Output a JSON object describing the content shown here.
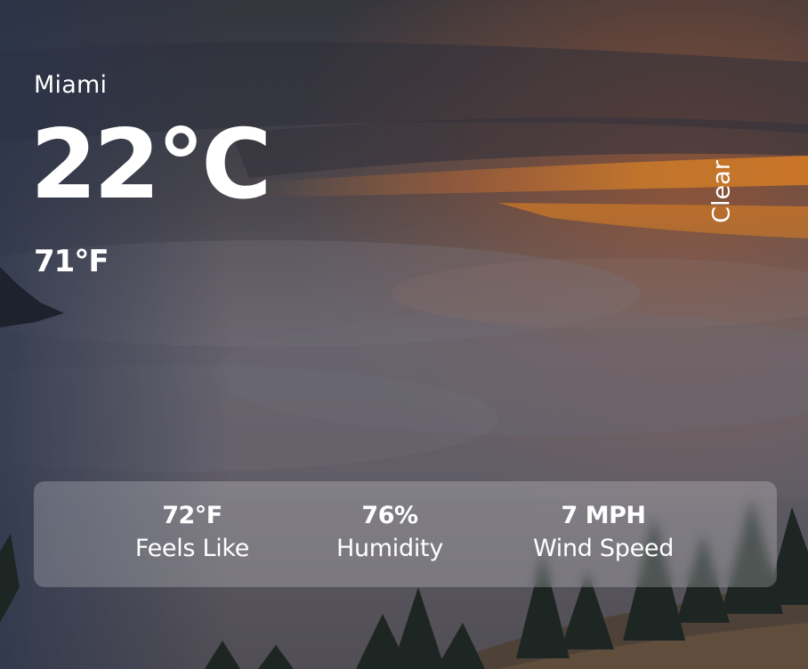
{
  "weather": {
    "city": "Miami",
    "temp_c": "22°C",
    "temp_f": "71°F",
    "condition": "Clear"
  },
  "stats": [
    {
      "value": "72°F",
      "label": "Feels Like"
    },
    {
      "value": "76%",
      "label": "Humidity"
    },
    {
      "value": "7 MPH",
      "label": "Wind Speed"
    }
  ],
  "colors": {
    "text": "#ffffff",
    "panel": "rgba(255,255,255,0.22)",
    "sunset_orange": "#e8872c",
    "sky_dark": "#2f3240"
  },
  "background": "sunset-over-clouds-image"
}
